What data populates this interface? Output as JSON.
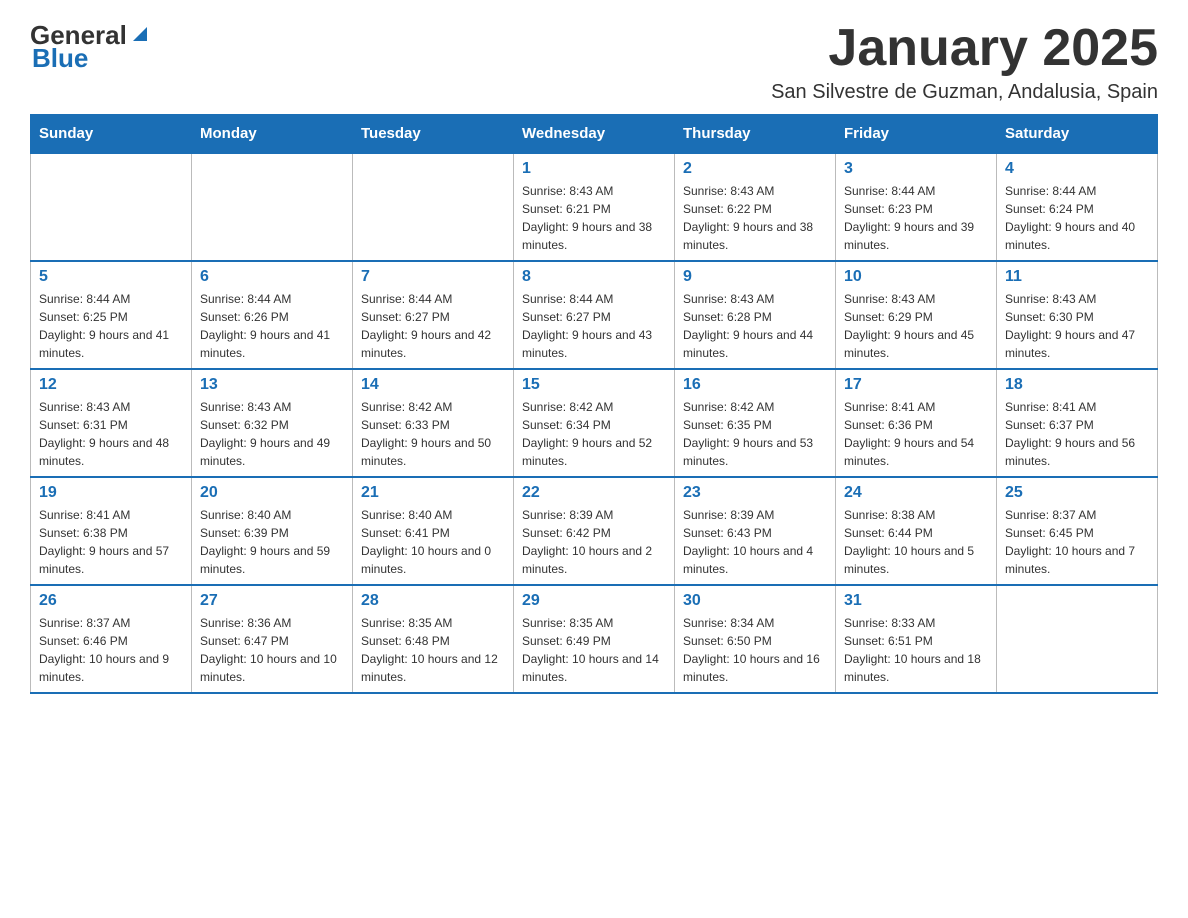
{
  "header": {
    "logo_general": "General",
    "logo_blue": "Blue",
    "title": "January 2025",
    "location": "San Silvestre de Guzman, Andalusia, Spain"
  },
  "days_of_week": [
    "Sunday",
    "Monday",
    "Tuesday",
    "Wednesday",
    "Thursday",
    "Friday",
    "Saturday"
  ],
  "weeks": [
    [
      {
        "day": "",
        "info": ""
      },
      {
        "day": "",
        "info": ""
      },
      {
        "day": "",
        "info": ""
      },
      {
        "day": "1",
        "info": "Sunrise: 8:43 AM\nSunset: 6:21 PM\nDaylight: 9 hours and 38 minutes."
      },
      {
        "day": "2",
        "info": "Sunrise: 8:43 AM\nSunset: 6:22 PM\nDaylight: 9 hours and 38 minutes."
      },
      {
        "day": "3",
        "info": "Sunrise: 8:44 AM\nSunset: 6:23 PM\nDaylight: 9 hours and 39 minutes."
      },
      {
        "day": "4",
        "info": "Sunrise: 8:44 AM\nSunset: 6:24 PM\nDaylight: 9 hours and 40 minutes."
      }
    ],
    [
      {
        "day": "5",
        "info": "Sunrise: 8:44 AM\nSunset: 6:25 PM\nDaylight: 9 hours and 41 minutes."
      },
      {
        "day": "6",
        "info": "Sunrise: 8:44 AM\nSunset: 6:26 PM\nDaylight: 9 hours and 41 minutes."
      },
      {
        "day": "7",
        "info": "Sunrise: 8:44 AM\nSunset: 6:27 PM\nDaylight: 9 hours and 42 minutes."
      },
      {
        "day": "8",
        "info": "Sunrise: 8:44 AM\nSunset: 6:27 PM\nDaylight: 9 hours and 43 minutes."
      },
      {
        "day": "9",
        "info": "Sunrise: 8:43 AM\nSunset: 6:28 PM\nDaylight: 9 hours and 44 minutes."
      },
      {
        "day": "10",
        "info": "Sunrise: 8:43 AM\nSunset: 6:29 PM\nDaylight: 9 hours and 45 minutes."
      },
      {
        "day": "11",
        "info": "Sunrise: 8:43 AM\nSunset: 6:30 PM\nDaylight: 9 hours and 47 minutes."
      }
    ],
    [
      {
        "day": "12",
        "info": "Sunrise: 8:43 AM\nSunset: 6:31 PM\nDaylight: 9 hours and 48 minutes."
      },
      {
        "day": "13",
        "info": "Sunrise: 8:43 AM\nSunset: 6:32 PM\nDaylight: 9 hours and 49 minutes."
      },
      {
        "day": "14",
        "info": "Sunrise: 8:42 AM\nSunset: 6:33 PM\nDaylight: 9 hours and 50 minutes."
      },
      {
        "day": "15",
        "info": "Sunrise: 8:42 AM\nSunset: 6:34 PM\nDaylight: 9 hours and 52 minutes."
      },
      {
        "day": "16",
        "info": "Sunrise: 8:42 AM\nSunset: 6:35 PM\nDaylight: 9 hours and 53 minutes."
      },
      {
        "day": "17",
        "info": "Sunrise: 8:41 AM\nSunset: 6:36 PM\nDaylight: 9 hours and 54 minutes."
      },
      {
        "day": "18",
        "info": "Sunrise: 8:41 AM\nSunset: 6:37 PM\nDaylight: 9 hours and 56 minutes."
      }
    ],
    [
      {
        "day": "19",
        "info": "Sunrise: 8:41 AM\nSunset: 6:38 PM\nDaylight: 9 hours and 57 minutes."
      },
      {
        "day": "20",
        "info": "Sunrise: 8:40 AM\nSunset: 6:39 PM\nDaylight: 9 hours and 59 minutes."
      },
      {
        "day": "21",
        "info": "Sunrise: 8:40 AM\nSunset: 6:41 PM\nDaylight: 10 hours and 0 minutes."
      },
      {
        "day": "22",
        "info": "Sunrise: 8:39 AM\nSunset: 6:42 PM\nDaylight: 10 hours and 2 minutes."
      },
      {
        "day": "23",
        "info": "Sunrise: 8:39 AM\nSunset: 6:43 PM\nDaylight: 10 hours and 4 minutes."
      },
      {
        "day": "24",
        "info": "Sunrise: 8:38 AM\nSunset: 6:44 PM\nDaylight: 10 hours and 5 minutes."
      },
      {
        "day": "25",
        "info": "Sunrise: 8:37 AM\nSunset: 6:45 PM\nDaylight: 10 hours and 7 minutes."
      }
    ],
    [
      {
        "day": "26",
        "info": "Sunrise: 8:37 AM\nSunset: 6:46 PM\nDaylight: 10 hours and 9 minutes."
      },
      {
        "day": "27",
        "info": "Sunrise: 8:36 AM\nSunset: 6:47 PM\nDaylight: 10 hours and 10 minutes."
      },
      {
        "day": "28",
        "info": "Sunrise: 8:35 AM\nSunset: 6:48 PM\nDaylight: 10 hours and 12 minutes."
      },
      {
        "day": "29",
        "info": "Sunrise: 8:35 AM\nSunset: 6:49 PM\nDaylight: 10 hours and 14 minutes."
      },
      {
        "day": "30",
        "info": "Sunrise: 8:34 AM\nSunset: 6:50 PM\nDaylight: 10 hours and 16 minutes."
      },
      {
        "day": "31",
        "info": "Sunrise: 8:33 AM\nSunset: 6:51 PM\nDaylight: 10 hours and 18 minutes."
      },
      {
        "day": "",
        "info": ""
      }
    ]
  ]
}
